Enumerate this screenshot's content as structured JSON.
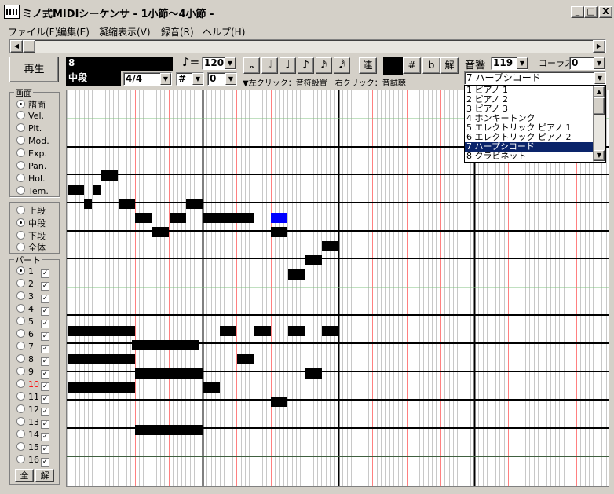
{
  "window": {
    "title": "ミノ式MIDIシーケンサ - 1小節～4小節 -",
    "min": "_",
    "max": "□",
    "close": "X"
  },
  "menu": [
    {
      "label": "ファイル(F)"
    },
    {
      "label": "編集(E)"
    },
    {
      "label": "凝縮表示(V)"
    },
    {
      "label": "録音(R)"
    },
    {
      "label": "ヘルプ(H)"
    }
  ],
  "play_label": "再生",
  "measure_value": "8",
  "section_value": "中段",
  "tempo": {
    "note_symbol": "♪=",
    "value": "120"
  },
  "time_signature": "4/4",
  "key_sharp": "#",
  "key_value": "0",
  "note_buttons": [
    "𝅝",
    "𝅗𝅥",
    "♩",
    "♪",
    "𝅘𝅥𝅯",
    "𝅘𝅥𝅰"
  ],
  "tie_label": "連",
  "accidentals": {
    "sharp": "#",
    "flat": "b",
    "natural": "解"
  },
  "hint": "▼左クリック：音符設置　右クリック：音試聴",
  "sound": {
    "label": "音響",
    "value": "119",
    "chorus_label": "コーラス",
    "chorus_value": "0",
    "instrument_selected": "7 ハープシコード"
  },
  "instrument_list": [
    "1 ピアノ 1",
    "2 ピアノ 2",
    "3 ピアノ 3",
    "4 ホンキートンク",
    "5 エレクトリック ピアノ 1",
    "6 エレクトリック ピアノ 2",
    "7 ハープシコード",
    "8 クラビネット"
  ],
  "instrument_selected_index": 6,
  "screen_group": {
    "title": "画面",
    "options": [
      "譜面",
      "Vel.",
      "Pit.",
      "Mod.",
      "Exp.",
      "Pan.",
      "Hol.",
      "Tem."
    ],
    "selected": 0
  },
  "range_group": {
    "options": [
      "上段",
      "中段",
      "下段",
      "全体"
    ],
    "selected": 1
  },
  "part_group": {
    "title": "パート",
    "parts": [
      "1",
      "2",
      "3",
      "4",
      "5",
      "6",
      "7",
      "8",
      "9",
      "10",
      "11",
      "12",
      "13",
      "14",
      "15",
      "16"
    ],
    "selected": 0,
    "highlight_index": 9,
    "highlight_color": "#ff0000",
    "all_label": "全",
    "clear_label": "解"
  },
  "colors": {
    "note": "#000000",
    "selected_note": "#0000ff",
    "red_line": "#ff8080",
    "green_line": "#80c080"
  }
}
